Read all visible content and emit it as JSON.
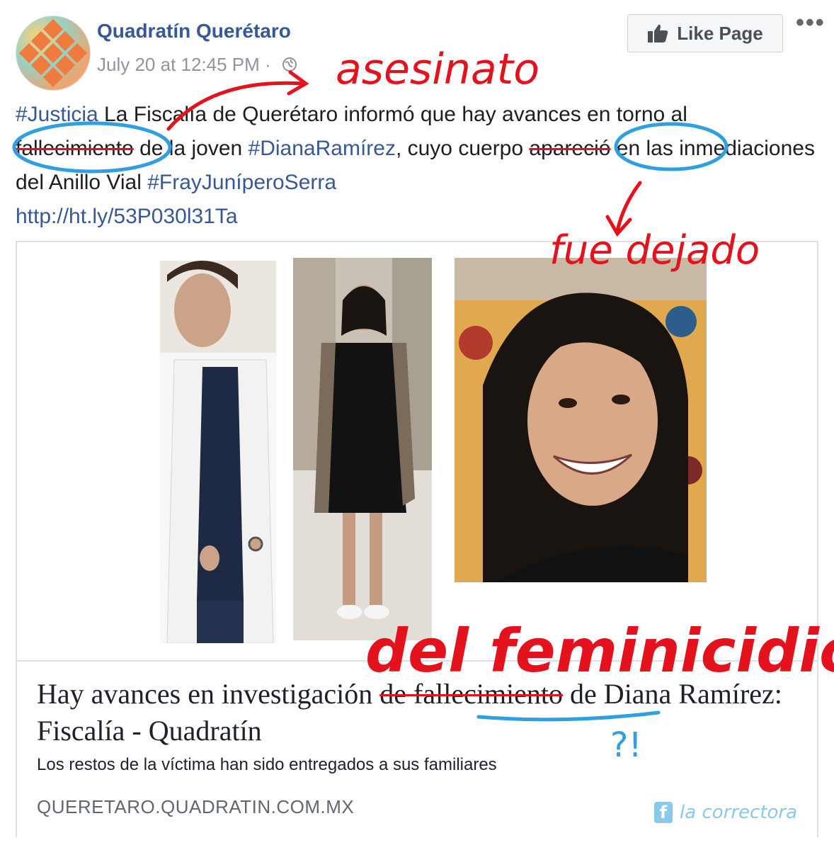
{
  "post": {
    "page_name": "Quadratín Querétaro",
    "timestamp": "July 20 at 12:45 PM",
    "separator": "·",
    "audience_icon": "globe-icon",
    "like_button_label": "Like Page",
    "more_label": "•••",
    "text": {
      "tag_justicia": "#Justicia",
      "seg1": " La Fiscalía de Querétaro informó que hay avances en torno al",
      "word_fallecimiento": "fallecimiento",
      "seg2": " de la joven ",
      "tag_diana": "#DianaRamírez",
      "seg3": ", cuyo cuerpo ",
      "word_aparecio": "apareció",
      "seg4": " en las inmediaciones del Anillo Vial ",
      "tag_fray": "#FrayJuníperoSerra",
      "link": "http://ht.ly/53P030l31Ta"
    }
  },
  "card": {
    "title_part1": "Hay avances en investigación ",
    "title_struck": "de fallecimiento",
    "title_part2": " de Diana Ramírez: Fiscalía - Quadratín",
    "description": "Los restos de la víctima han sido entregados a sus familiares",
    "domain": "QUERETARO.QUADRATIN.COM.MX"
  },
  "annotations": {
    "asesinato": "asesinato",
    "fue_dejado": "fue dejado",
    "del_feminicidio": "del feminicidio",
    "question": "?!"
  },
  "watermark": {
    "icon": "facebook-icon",
    "text": "la correctora"
  },
  "colors": {
    "link_blue": "#365899",
    "annotation_red": "#e3121d",
    "annotation_blue": "#2f9fe0",
    "meta_gray": "#90949c"
  }
}
